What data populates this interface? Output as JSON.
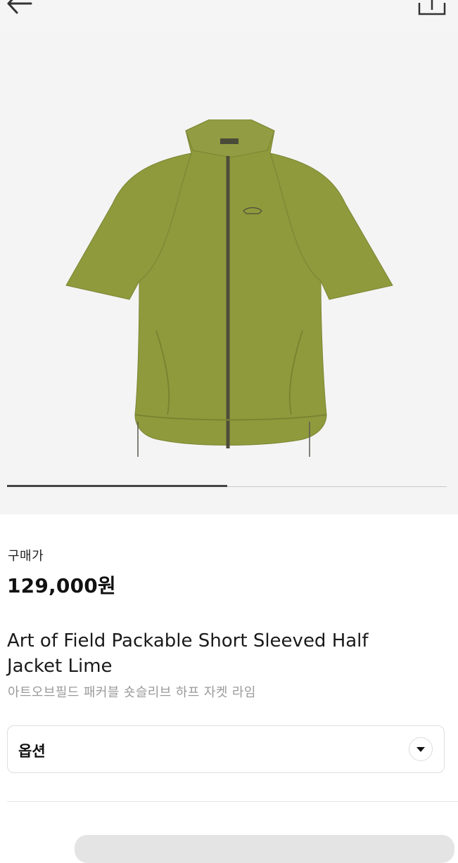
{
  "header": {
    "back_icon": "arrow-left-icon",
    "share_icon": "share-upload-icon"
  },
  "gallery": {
    "image_alt": "Green short sleeved half zip jacket",
    "progress": 0.5
  },
  "product": {
    "price_label": "구매가",
    "price": "129,000원",
    "title": "Art of Field Packable Short Sleeved Half Jacket Lime",
    "subtitle": "아트오브필드 패커블 숏슬리브 하프 자켓 라임"
  },
  "options": {
    "label": "옵션",
    "chevron_icon": "chevron-down-icon"
  },
  "colors": {
    "jacket": "#8f9a3d",
    "price_text": "#111111",
    "muted_text": "#9a9a9a"
  }
}
